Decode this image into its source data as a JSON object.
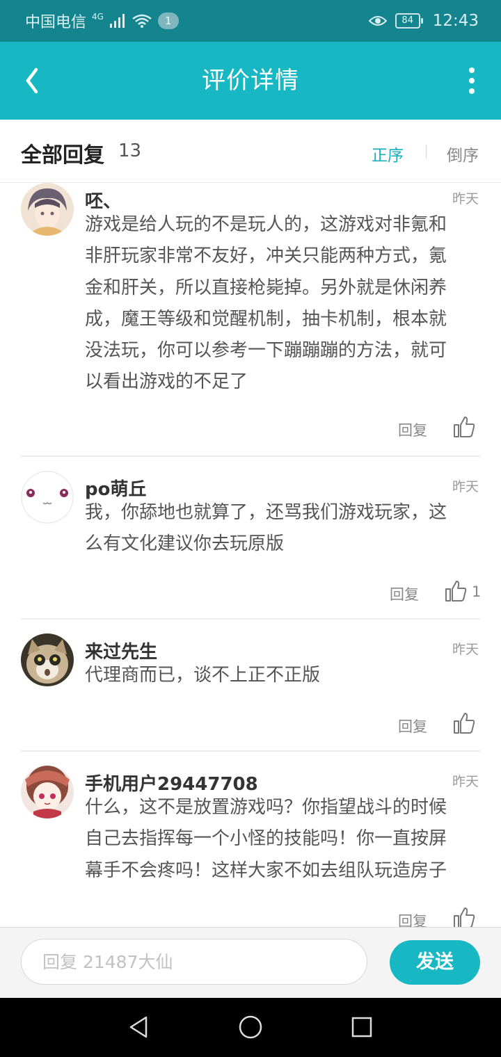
{
  "status": {
    "carrier": "中国电信",
    "network": "4G",
    "badge": "1",
    "battery": "84",
    "time": "12:43"
  },
  "appbar": {
    "title": "评价详情"
  },
  "replies_header": {
    "label": "全部回复",
    "count": "13",
    "sort_asc": "正序",
    "sort_desc": "倒序"
  },
  "comments": [
    {
      "user": "呸、",
      "time": "昨天",
      "lines": [
        "游戏是给人玩的不是玩人的，这游戏对非氪和",
        "非肝玩家非常不友好，冲关只能两种方式，氪",
        "金和肝关，所以直接枪毙掉。另外就是休闲养",
        "成，魔王等级和觉醒机制，抽卡机制，根本就",
        "没法玩，你可以参考一下蹦蹦蹦的方法，就可",
        "以看出游戏的不足了"
      ],
      "reply": "回复",
      "likes": ""
    },
    {
      "user": "po萌丘",
      "time": "昨天",
      "lines": [
        "我，你舔地也就算了，还骂我们游戏玩家，这",
        "么有文化建议你去玩原版"
      ],
      "reply": "回复",
      "likes": "1"
    },
    {
      "user": "来过先生",
      "time": "昨天",
      "lines": [
        "代理商而已，谈不上正不正版"
      ],
      "reply": "回复",
      "likes": ""
    },
    {
      "user": "手机用户29447708",
      "time": "昨天",
      "lines": [
        "什么，这不是放置游戏吗？你指望战斗的时候",
        "自己去指挥每一个小怪的技能吗！你一直按屏",
        "幕手不会疼吗！这样大家不如去组队玩造房子"
      ],
      "reply": "回复",
      "likes": ""
    }
  ],
  "input": {
    "placeholder": "回复 21487大仙"
  },
  "send": {
    "label": "发送"
  },
  "colors": {
    "accent": "#17b8c4",
    "statusbar": "#14858f"
  }
}
